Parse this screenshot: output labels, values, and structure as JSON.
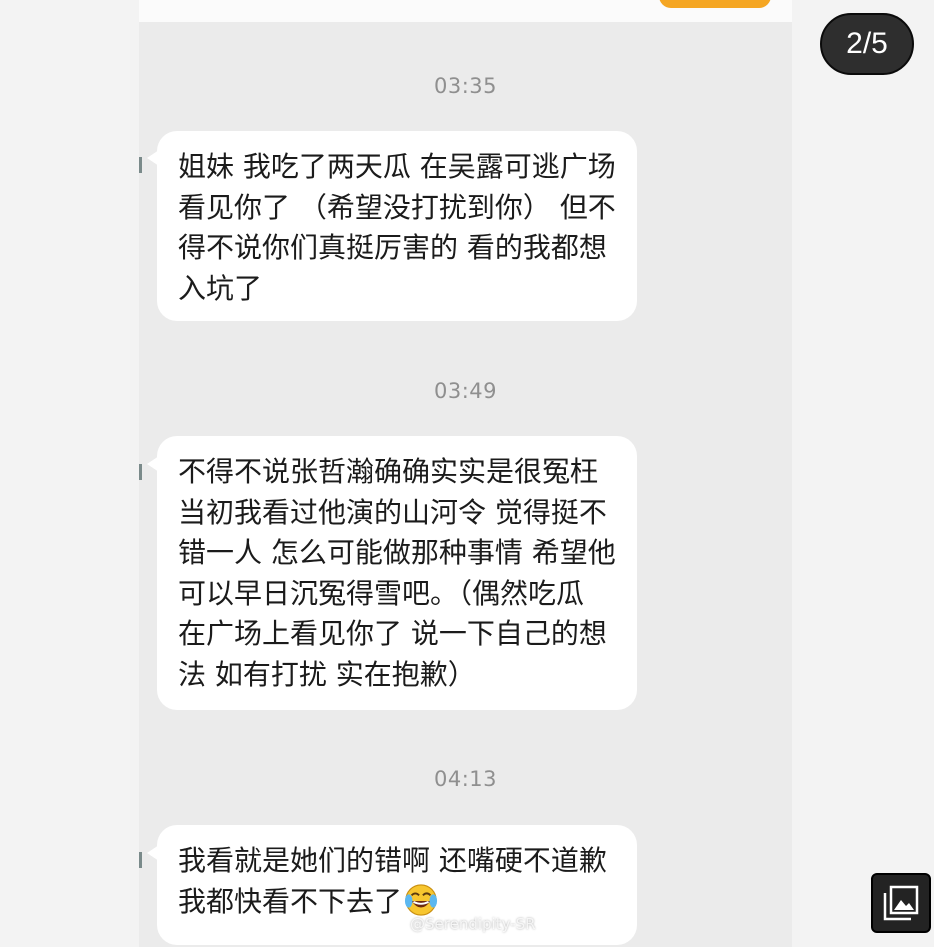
{
  "viewer": {
    "page_counter": "2/5",
    "gallery_icon": "gallery-icon"
  },
  "chat": {
    "messages": [
      {
        "time": "03:35",
        "lines": [
          "姐妹 我吃了两天瓜 在吴露可逃广场",
          "看见你了 （希望没打扰到你） 但不",
          "得不说你们真挺厉害的 看的我都想",
          "入坑了"
        ]
      },
      {
        "time": "03:49",
        "lines": [
          "不得不说张哲瀚确确实实是很冤枉",
          "当初我看过他演的山河令 觉得挺不",
          "错一人 怎么可能做那种事情 希望他",
          "可以早日沉冤得雪吧。（偶然吃瓜",
          "在广场上看见你了 说一下自己的想",
          "法 如有打扰 实在抱歉）"
        ]
      },
      {
        "time": "04:13",
        "lines": [
          "我看就是她们的错啊 还嘴硬不道歉",
          "我都快看不下去了"
        ],
        "emoji": "laughing-crying-emoji"
      }
    ]
  },
  "watermark": {
    "text": "@Serendipity-SR",
    "icon": "weibo-icon"
  },
  "colors": {
    "chat_background": "#ebebeb",
    "bubble": "#ffffff",
    "timestamp": "#8f8f8f",
    "counter_bg": "#2e2e2e",
    "accent_orange": "#f5a623"
  }
}
